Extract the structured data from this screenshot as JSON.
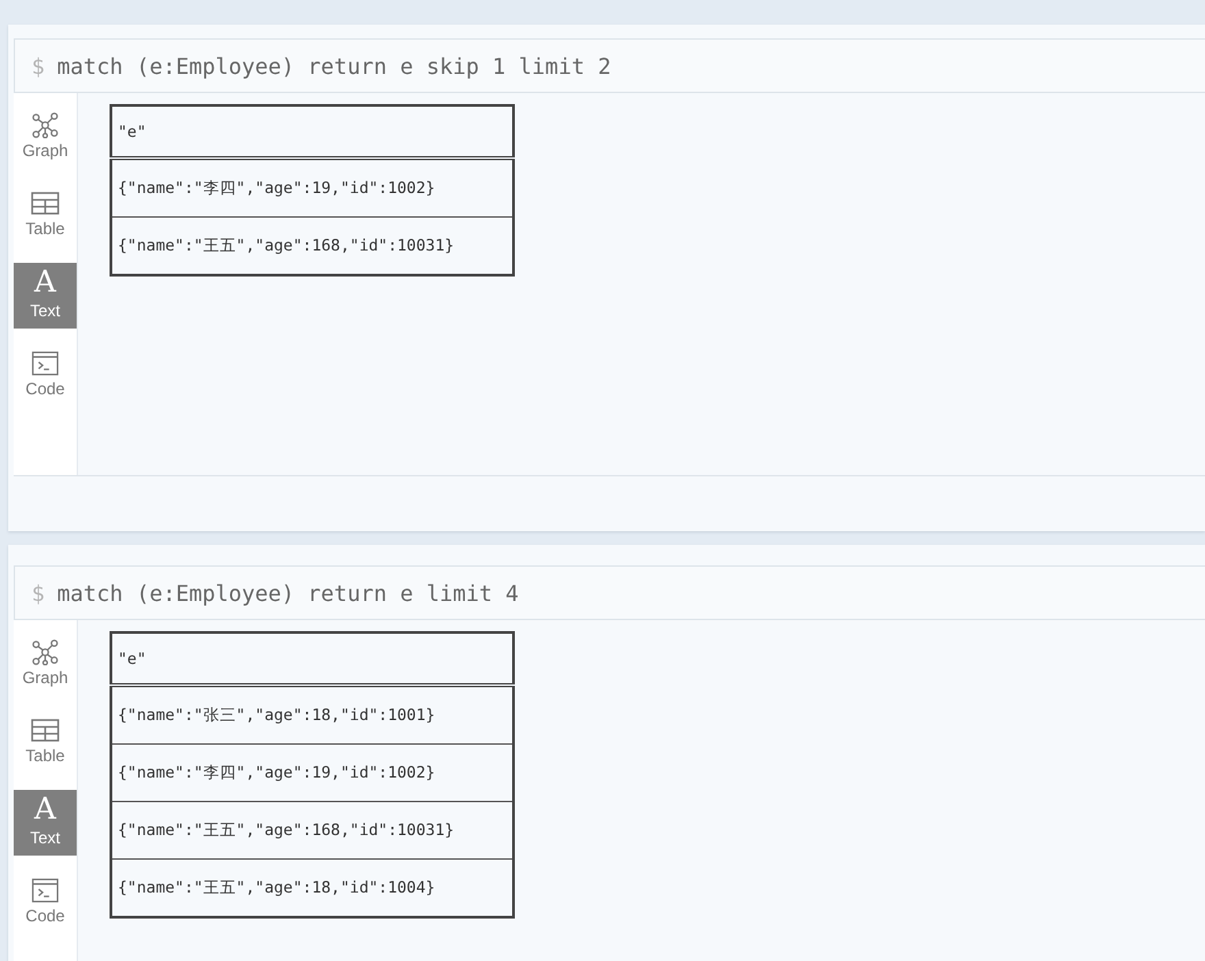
{
  "frames": [
    {
      "prompt": "$",
      "query": "match (e:Employee) return e skip 1 limit 2",
      "views": [
        {
          "kind": "graph",
          "label": "Graph",
          "selected": false
        },
        {
          "kind": "table",
          "label": "Table",
          "selected": false
        },
        {
          "kind": "text",
          "glyph": "A",
          "label": "Text",
          "selected": true
        },
        {
          "kind": "code",
          "label": "Code",
          "selected": false
        }
      ],
      "result": {
        "header": "\"e\"",
        "rows": [
          "{\"name\":\"李四\",\"age\":19,\"id\":1002}",
          "{\"name\":\"王五\",\"age\":168,\"id\":10031}"
        ]
      }
    },
    {
      "prompt": "$",
      "query": "match (e:Employee) return e limit 4",
      "views": [
        {
          "kind": "graph",
          "label": "Graph",
          "selected": false
        },
        {
          "kind": "table",
          "label": "Table",
          "selected": false
        },
        {
          "kind": "text",
          "glyph": "A",
          "label": "Text",
          "selected": true
        },
        {
          "kind": "code",
          "label": "Code",
          "selected": false
        }
      ],
      "result": {
        "header": "\"e\"",
        "rows": [
          "{\"name\":\"张三\",\"age\":18,\"id\":1001}",
          "{\"name\":\"李四\",\"age\":19,\"id\":1002}",
          "{\"name\":\"王五\",\"age\":168,\"id\":10031}",
          "{\"name\":\"王五\",\"age\":18,\"id\":1004}"
        ]
      }
    }
  ]
}
